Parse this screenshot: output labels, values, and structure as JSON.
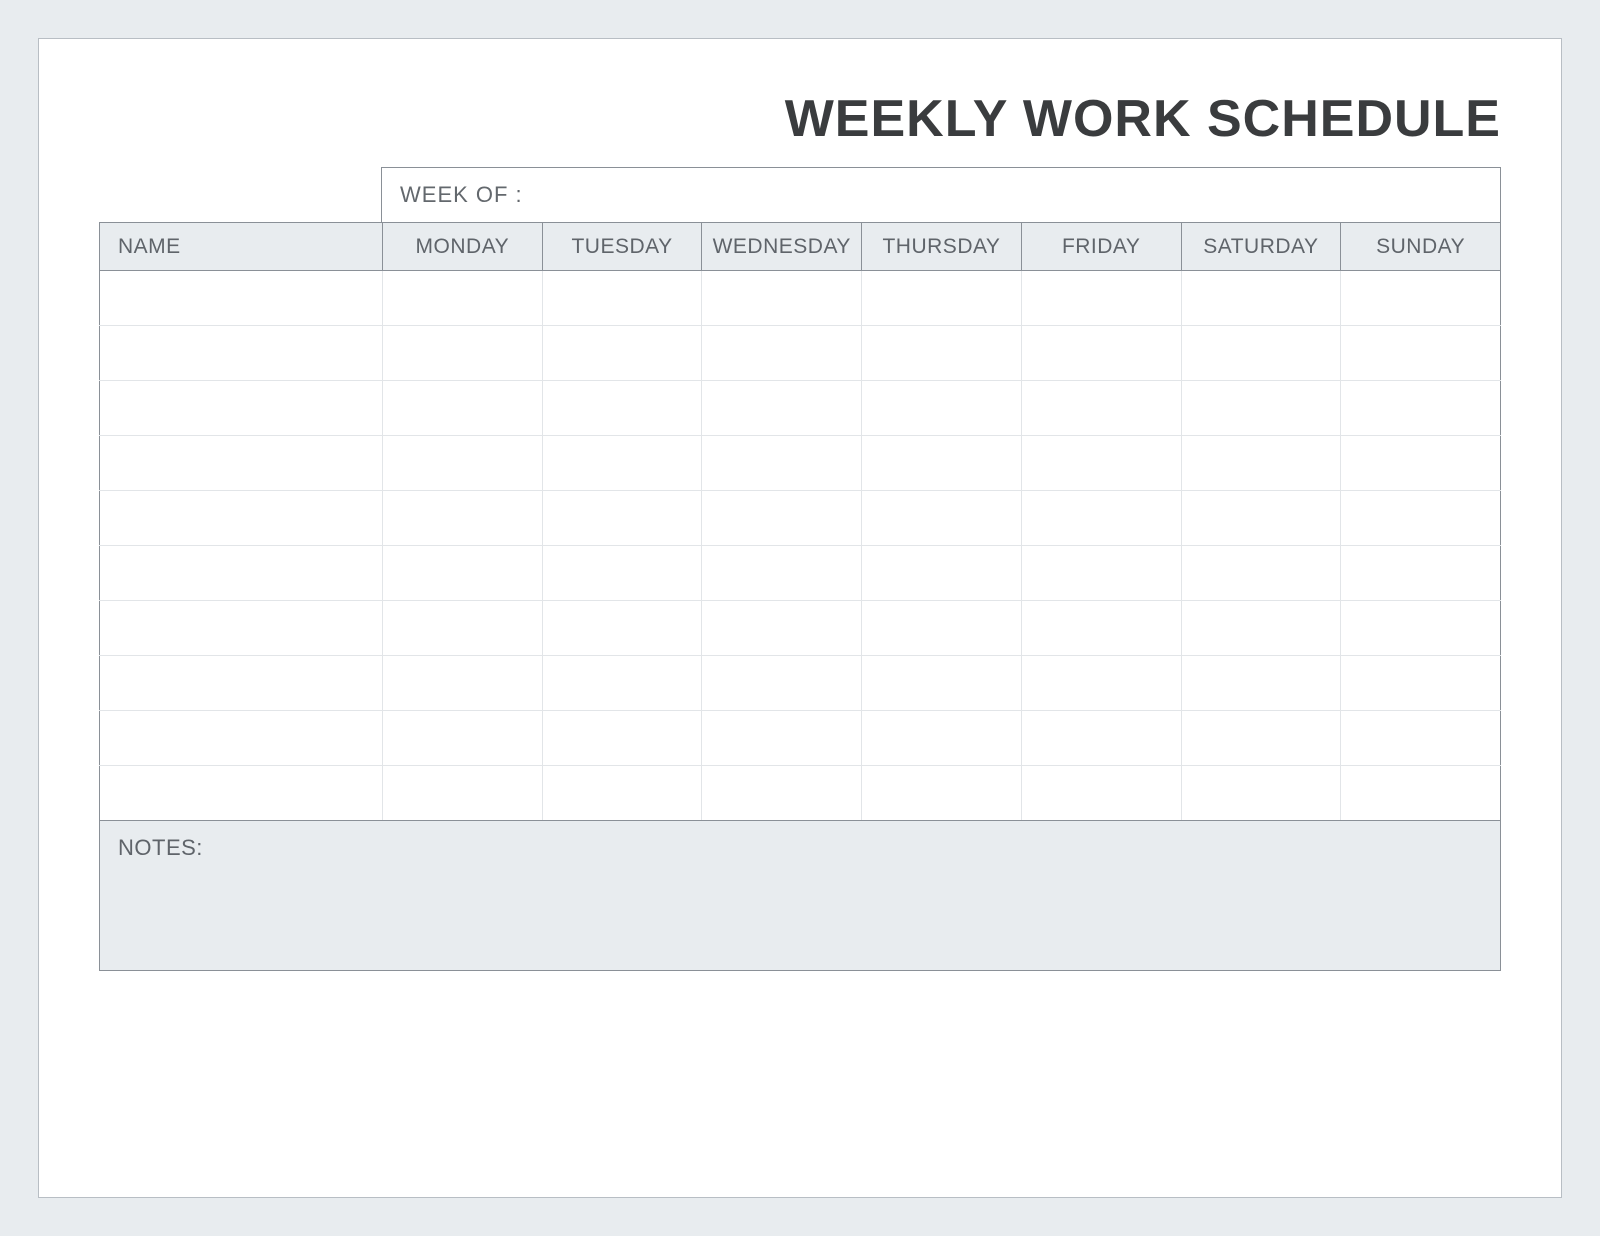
{
  "title": "WEEKLY WORK SCHEDULE",
  "week_of_label": "WEEK OF :",
  "week_of_value": "",
  "columns": {
    "name": "NAME",
    "days": [
      "MONDAY",
      "TUESDAY",
      "WEDNESDAY",
      "THURSDAY",
      "FRIDAY",
      "SATURDAY",
      "SUNDAY"
    ]
  },
  "rows": [
    {
      "name": "",
      "mon": "",
      "tue": "",
      "wed": "",
      "thu": "",
      "fri": "",
      "sat": "",
      "sun": ""
    },
    {
      "name": "",
      "mon": "",
      "tue": "",
      "wed": "",
      "thu": "",
      "fri": "",
      "sat": "",
      "sun": ""
    },
    {
      "name": "",
      "mon": "",
      "tue": "",
      "wed": "",
      "thu": "",
      "fri": "",
      "sat": "",
      "sun": ""
    },
    {
      "name": "",
      "mon": "",
      "tue": "",
      "wed": "",
      "thu": "",
      "fri": "",
      "sat": "",
      "sun": ""
    },
    {
      "name": "",
      "mon": "",
      "tue": "",
      "wed": "",
      "thu": "",
      "fri": "",
      "sat": "",
      "sun": ""
    },
    {
      "name": "",
      "mon": "",
      "tue": "",
      "wed": "",
      "thu": "",
      "fri": "",
      "sat": "",
      "sun": ""
    },
    {
      "name": "",
      "mon": "",
      "tue": "",
      "wed": "",
      "thu": "",
      "fri": "",
      "sat": "",
      "sun": ""
    },
    {
      "name": "",
      "mon": "",
      "tue": "",
      "wed": "",
      "thu": "",
      "fri": "",
      "sat": "",
      "sun": ""
    },
    {
      "name": "",
      "mon": "",
      "tue": "",
      "wed": "",
      "thu": "",
      "fri": "",
      "sat": "",
      "sun": ""
    },
    {
      "name": "",
      "mon": "",
      "tue": "",
      "wed": "",
      "thu": "",
      "fri": "",
      "sat": "",
      "sun": ""
    }
  ],
  "notes_label": "NOTES:",
  "notes_value": ""
}
